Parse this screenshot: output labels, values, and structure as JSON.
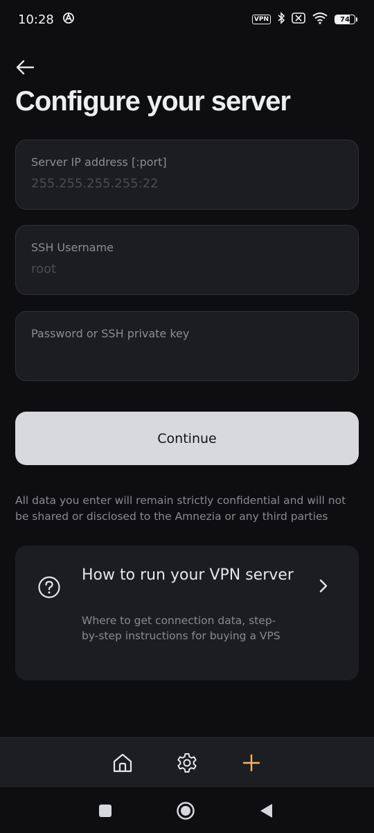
{
  "status_bar": {
    "time": "10:28",
    "vpn_label": "VPN",
    "battery": "74",
    "battery_level_percent": 74
  },
  "title": "Configure your server",
  "fields": {
    "server_ip": {
      "label": "Server IP address [:port]",
      "value": "",
      "placeholder": "255.255.255.255:22"
    },
    "ssh_username": {
      "label": "SSH Username",
      "value": "",
      "placeholder": "root"
    },
    "password": {
      "label": "Password or SSH private key",
      "value": "",
      "placeholder": ""
    }
  },
  "continue_button": "Continue",
  "disclaimer": "All data you enter will remain strictly confidential and will not be shared or disclosed to the Amnezia or any third parties",
  "help_card": {
    "title": "How to run your VPN server",
    "description": "Where to get connection data, step-by-step instructions for buying a VPS"
  },
  "bottom_nav": {
    "items": [
      {
        "icon": "home-icon"
      },
      {
        "icon": "gear-icon"
      },
      {
        "icon": "plus-icon"
      }
    ]
  },
  "colors": {
    "background": "#0e0e11",
    "card": "#1c1d21",
    "button": "#d8d9dd",
    "accent": "#fbb26a"
  }
}
